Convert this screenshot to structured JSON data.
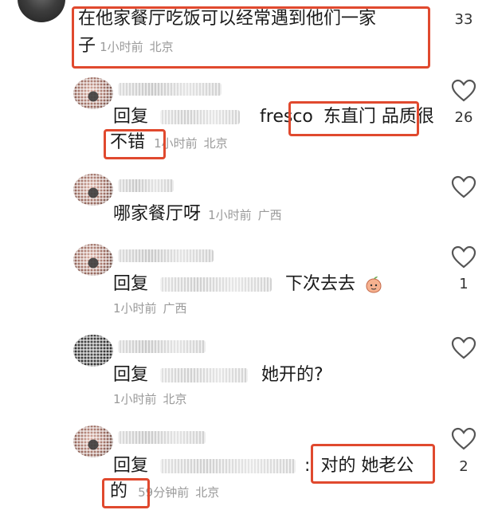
{
  "top_comment": {
    "line1": "在他家餐厅吃饭可以经常遇到他们一家",
    "line2": "子",
    "time": "1小时前",
    "location": "北京",
    "likes": "33"
  },
  "replies": [
    {
      "reply_word": "回复",
      "target_suffix": "fresco",
      "text_part1": "东直门 品质很",
      "text_part2": "不错",
      "time": "1小时前",
      "location": "北京",
      "likes": "26"
    },
    {
      "text": "哪家餐厅呀",
      "time": "1小时前",
      "location": "广西",
      "likes": ""
    },
    {
      "reply_word": "回复",
      "text": "下次去去",
      "emoji": "peach-emoji",
      "time": "1小时前",
      "location": "广西",
      "likes": "1"
    },
    {
      "reply_word": "回复",
      "text": "她开的?",
      "time": "1小时前",
      "location": "北京",
      "likes": ""
    },
    {
      "reply_word": "回复",
      "colon": ":",
      "text_part1": "对的 她老公",
      "text_part2": "的",
      "time": "59分钟前",
      "location": "北京",
      "likes": "2"
    }
  ],
  "colors": {
    "highlight_box": "#e0492e",
    "meta_text": "#9a9a9a"
  }
}
